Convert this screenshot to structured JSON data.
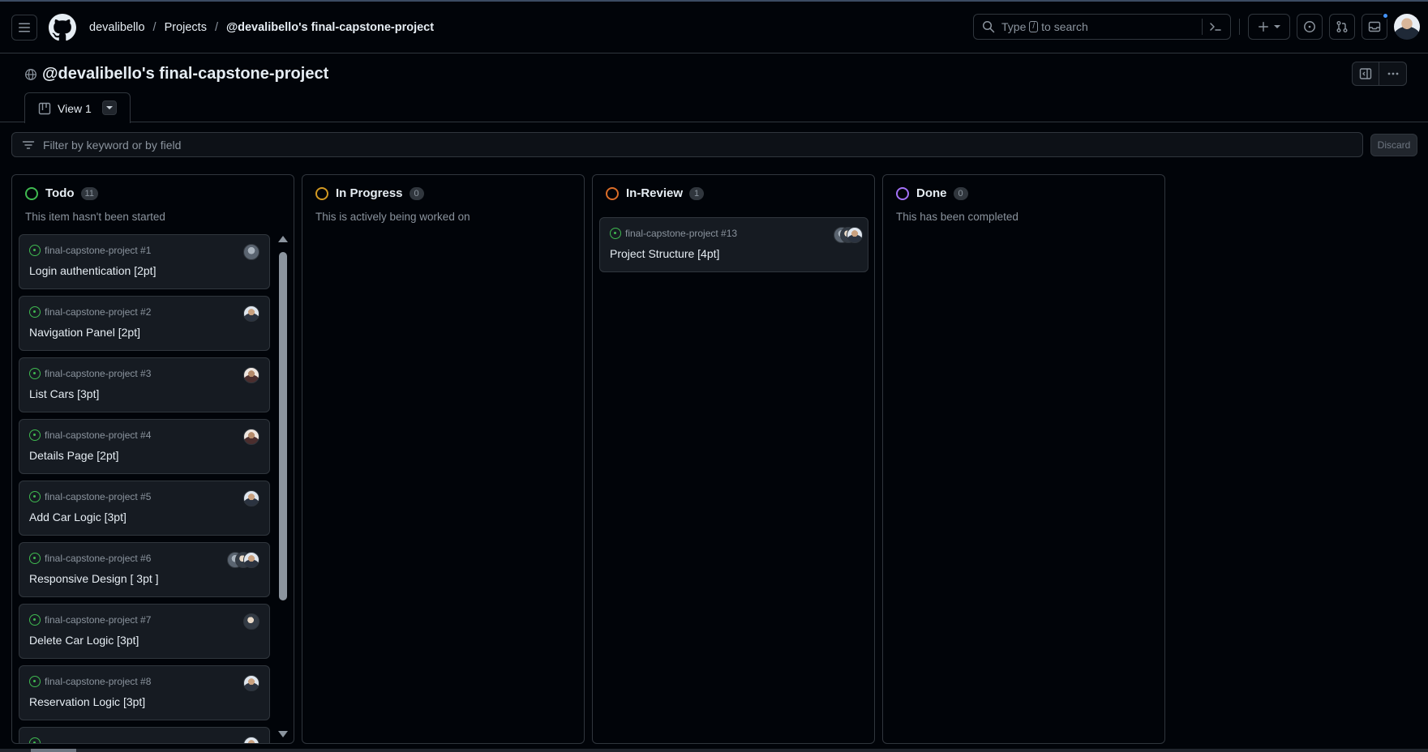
{
  "header": {
    "breadcrumb": [
      "devalibello",
      "Projects",
      "@devalibello's final-capstone-project"
    ],
    "search_prefix": "Type",
    "search_key": "/",
    "search_suffix": "to search"
  },
  "project": {
    "title": "@devalibello's final-capstone-project",
    "view_tab": "View 1"
  },
  "filter": {
    "placeholder": "Filter by keyword or by field",
    "discard_label": "Discard"
  },
  "columns": [
    {
      "name": "Todo",
      "count": "11",
      "description": "This item hasn't been started",
      "color": "#3fb950",
      "cards": [
        {
          "ref": "final-capstone-project #1",
          "title": "Login authentication [2pt]"
        },
        {
          "ref": "final-capstone-project #2",
          "title": "Navigation Panel [2pt]"
        },
        {
          "ref": "final-capstone-project #3",
          "title": "List Cars [3pt]"
        },
        {
          "ref": "final-capstone-project #4",
          "title": "Details Page [2pt]"
        },
        {
          "ref": "final-capstone-project #5",
          "title": "Add Car Logic [3pt]"
        },
        {
          "ref": "final-capstone-project #6",
          "title": "Responsive Design [ 3pt ]"
        },
        {
          "ref": "final-capstone-project #7",
          "title": "Delete Car Logic [3pt]"
        },
        {
          "ref": "final-capstone-project #8",
          "title": "Reservation Logic [3pt]"
        }
      ]
    },
    {
      "name": "In Progress",
      "count": "0",
      "description": "This is actively being worked on",
      "color": "#d29922"
    },
    {
      "name": "In-Review",
      "count": "1",
      "description": "",
      "color": "#db6d28",
      "cards": [
        {
          "ref": "final-capstone-project #13",
          "title": "Project Structure [4pt]"
        }
      ]
    },
    {
      "name": "Done",
      "count": "0",
      "description": "This has been completed",
      "color": "#a371f7"
    }
  ],
  "icons": {
    "menu": "hamburger-icon",
    "logo": "github-logo",
    "search": "search-icon",
    "command": "command-palette-icon",
    "plus": "plus-icon",
    "issues": "issue-opened-icon",
    "pulls": "git-pull-request-icon",
    "inbox": "inbox-icon",
    "globe": "globe-icon",
    "layout": "sidebar-icon",
    "more": "kebab-horizontal-icon",
    "board": "project-board-icon",
    "filter": "filter-icon"
  }
}
